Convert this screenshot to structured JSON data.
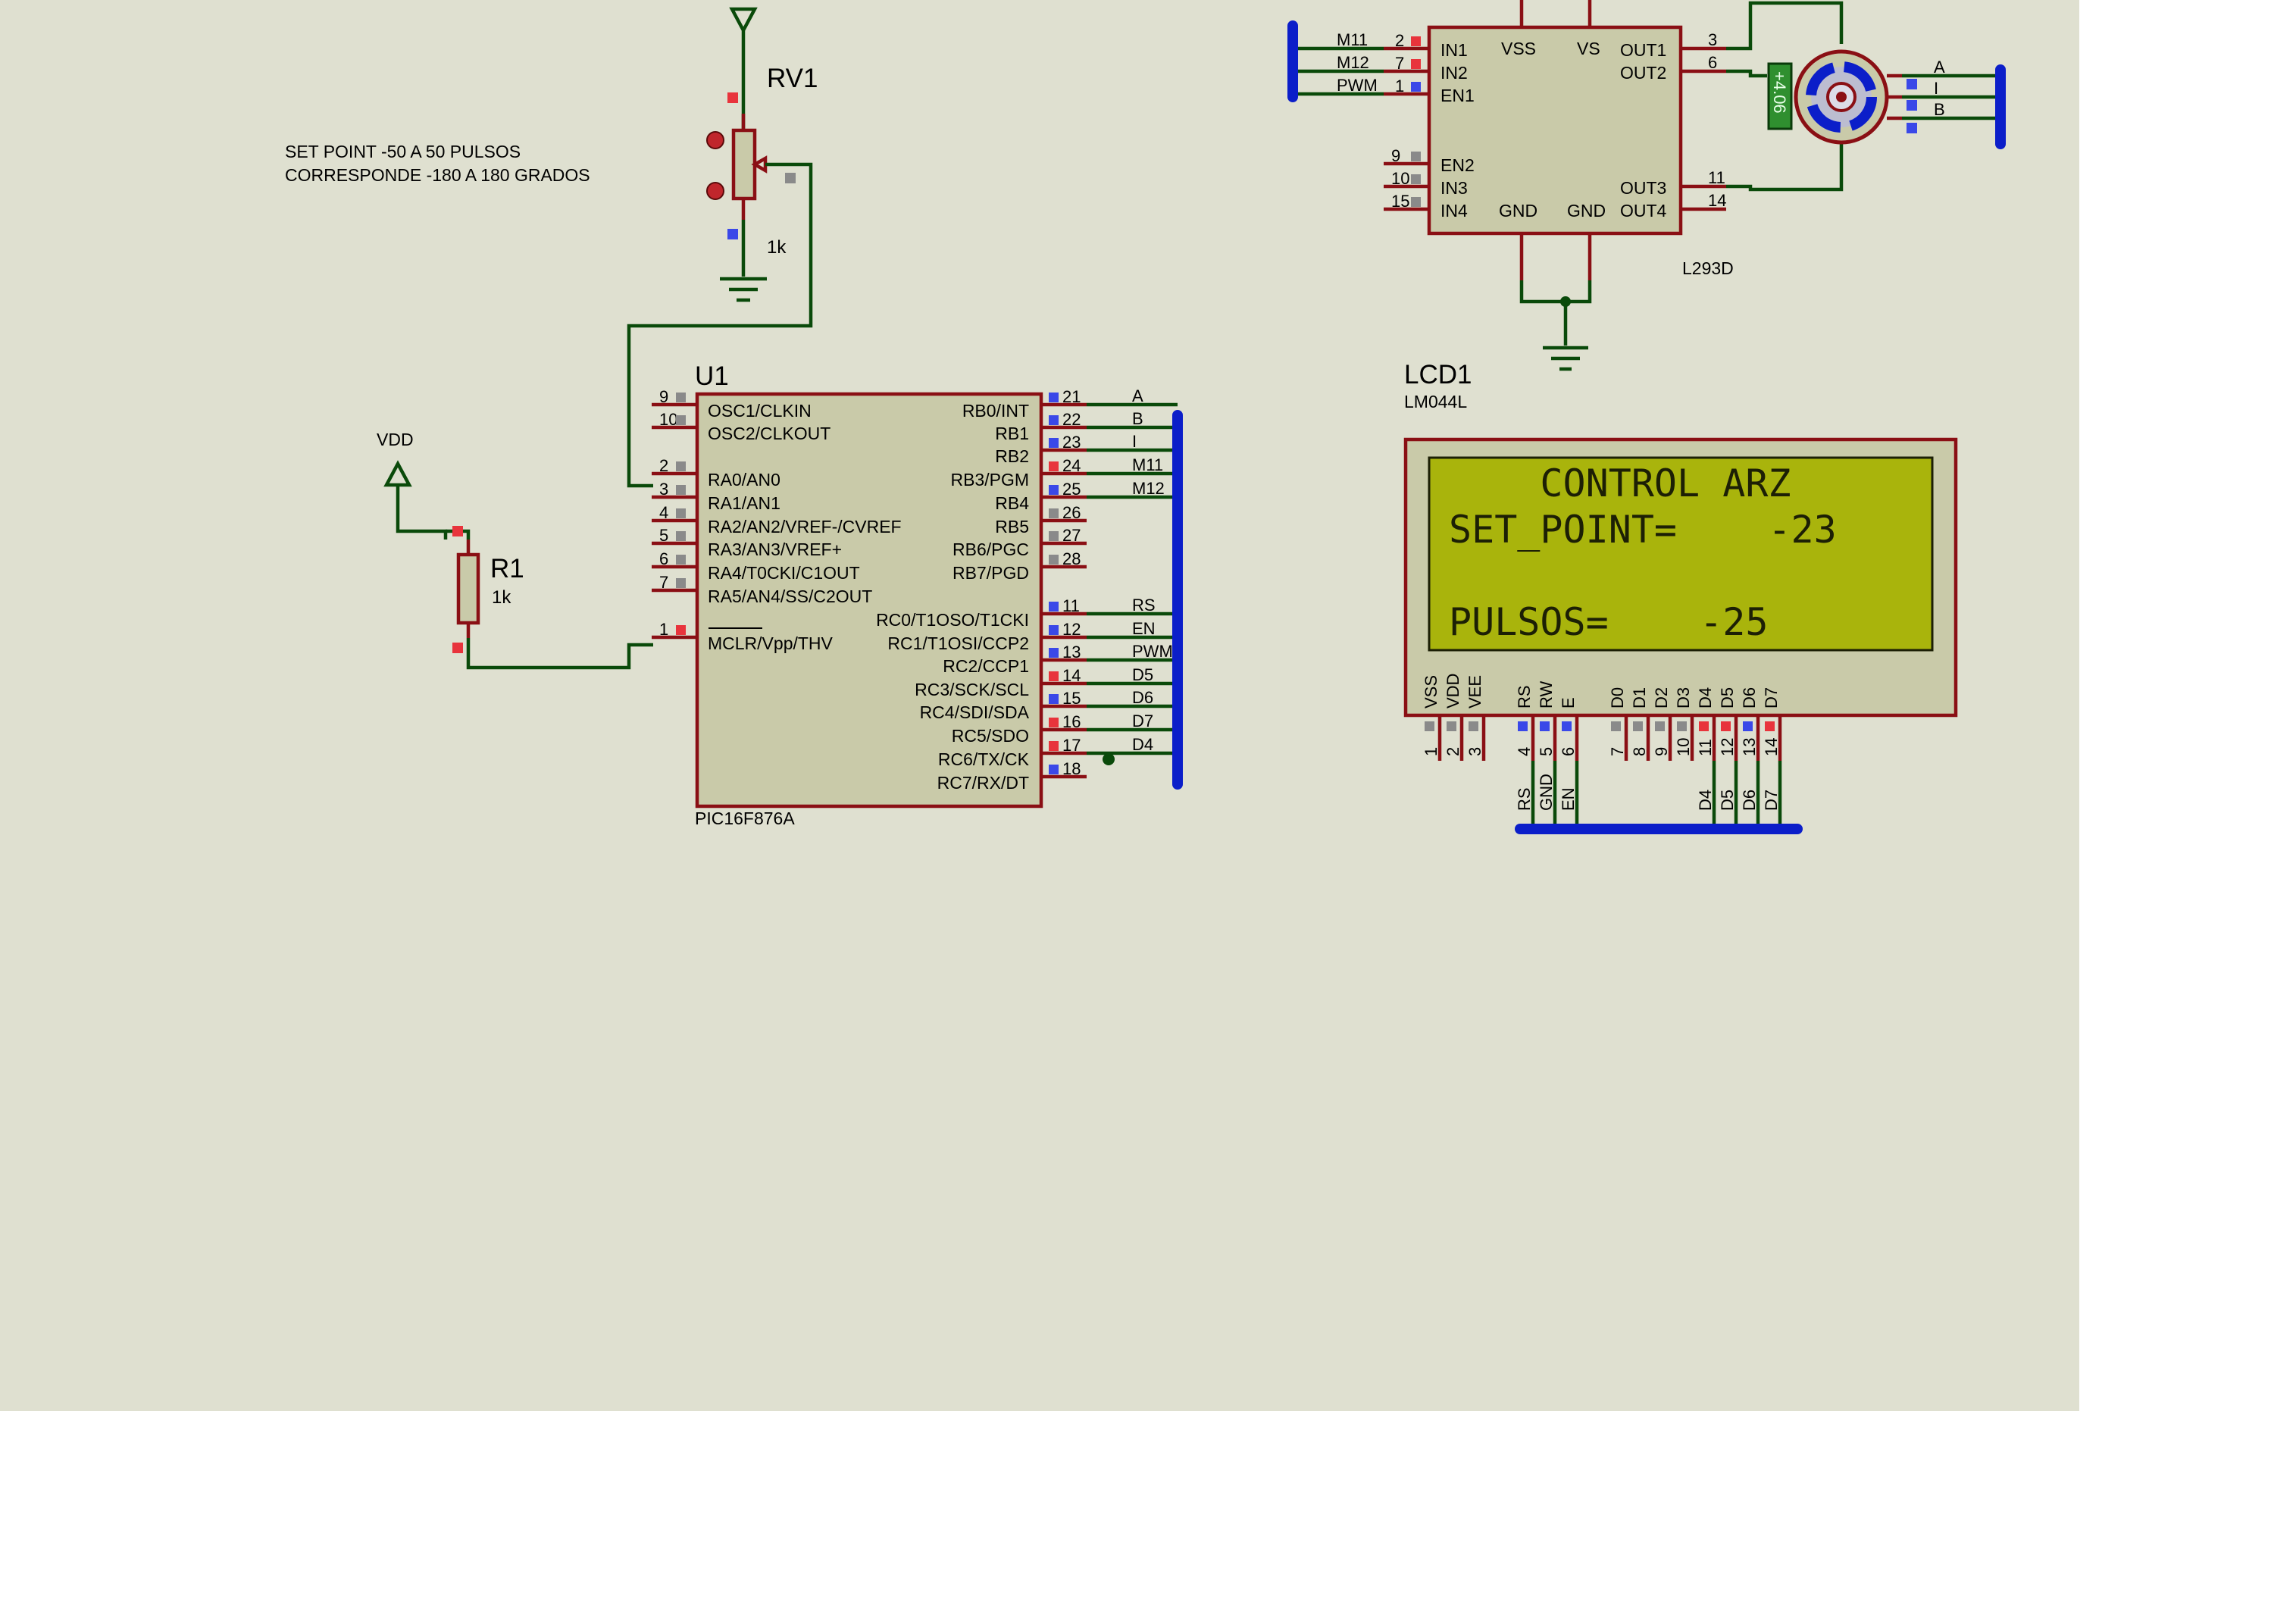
{
  "colors": {
    "sheet": "#dfe0d0",
    "wire": "#0a4a0a",
    "pin": "#8a0f14",
    "bus": "#0b1ec9",
    "chip_fill": "#c9caa9",
    "lcd_screen": "#a9b40c",
    "pin_high": "#e8343c",
    "pin_low": "#3a48e8",
    "pin_float": "#8a8a8a"
  },
  "note": {
    "line1": "SET POINT -50 A 50  PULSOS",
    "line2": "CORRESPONDE -180 A 180 GRADOS"
  },
  "rv1": {
    "ref": "RV1",
    "value": "1k"
  },
  "r1": {
    "ref": "R1",
    "value": "1k"
  },
  "vdd": {
    "label": "VDD"
  },
  "u1": {
    "ref": "U1",
    "part": "PIC16F876A",
    "left_pins": [
      {
        "num": "9",
        "name": "OSC1/CLKIN"
      },
      {
        "num": "10",
        "name": "OSC2/CLKOUT"
      },
      {
        "num": "2",
        "name": "RA0/AN0"
      },
      {
        "num": "3",
        "name": "RA1/AN1"
      },
      {
        "num": "4",
        "name": "RA2/AN2/VREF-/CVREF"
      },
      {
        "num": "5",
        "name": "RA3/AN3/VREF+"
      },
      {
        "num": "6",
        "name": "RA4/T0CKI/C1OUT"
      },
      {
        "num": "7",
        "name": "RA5/AN4/SS/C2OUT"
      },
      {
        "num": "1",
        "name": "MCLR/Vpp/THV"
      }
    ],
    "right_pins": [
      {
        "num": "21",
        "name": "RB0/INT",
        "net": "A"
      },
      {
        "num": "22",
        "name": "RB1",
        "net": "B"
      },
      {
        "num": "23",
        "name": "RB2",
        "net": "I"
      },
      {
        "num": "24",
        "name": "RB3/PGM",
        "net": "M11"
      },
      {
        "num": "25",
        "name": "RB4",
        "net": "M12"
      },
      {
        "num": "26",
        "name": "RB5",
        "net": ""
      },
      {
        "num": "27",
        "name": "RB6/PGC",
        "net": ""
      },
      {
        "num": "28",
        "name": "RB7/PGD",
        "net": ""
      },
      {
        "num": "11",
        "name": "RC0/T1OSO/T1CKI",
        "net": "RS"
      },
      {
        "num": "12",
        "name": "RC1/T1OSI/CCP2",
        "net": "EN"
      },
      {
        "num": "13",
        "name": "RC2/CCP1",
        "net": "PWM"
      },
      {
        "num": "14",
        "name": "RC3/SCK/SCL",
        "net": "D5"
      },
      {
        "num": "15",
        "name": "RC4/SDI/SDA",
        "net": "D6"
      },
      {
        "num": "16",
        "name": "RC5/SDO",
        "net": "D7"
      },
      {
        "num": "17",
        "name": "RC6/TX/CK",
        "net": "D4"
      },
      {
        "num": "18",
        "name": "RC7/RX/DT",
        "net": ""
      }
    ]
  },
  "l293": {
    "part": "L293D",
    "inner": {
      "in1": "IN1",
      "in2": "IN2",
      "en1": "EN1",
      "en2": "EN2",
      "in3": "IN3",
      "in4": "IN4",
      "vss": "VSS",
      "vs": "VS",
      "gnd": "GND",
      "out1": "OUT1",
      "out2": "OUT2",
      "out3": "OUT3",
      "out4": "OUT4"
    },
    "left_nets": [
      {
        "net": "M11",
        "num": "2"
      },
      {
        "net": "M12",
        "num": "7"
      },
      {
        "net": "PWM",
        "num": "1"
      }
    ],
    "left_nums_lower": [
      "9",
      "10",
      "15"
    ],
    "right_nums": [
      "3",
      "6",
      "11",
      "14"
    ]
  },
  "motor": {
    "counter": "+4.06",
    "nets": [
      "A",
      "I",
      "B"
    ]
  },
  "lcd": {
    "ref": "LCD1",
    "part": "LM044L",
    "lines": [
      "    CONTROL ARZ",
      "SET_POINT=    -23",
      "",
      "PULSOS=    -25"
    ],
    "pins": [
      {
        "name": "VSS",
        "num": "1"
      },
      {
        "name": "VDD",
        "num": "2"
      },
      {
        "name": "VEE",
        "num": "3"
      },
      {
        "name": "RS",
        "num": "4"
      },
      {
        "name": "RW",
        "num": "5"
      },
      {
        "name": "E",
        "num": "6"
      },
      {
        "name": "D0",
        "num": "7"
      },
      {
        "name": "D1",
        "num": "8"
      },
      {
        "name": "D2",
        "num": "9"
      },
      {
        "name": "D3",
        "num": "10"
      },
      {
        "name": "D4",
        "num": "11"
      },
      {
        "name": "D5",
        "num": "12"
      },
      {
        "name": "D6",
        "num": "13"
      },
      {
        "name": "D7",
        "num": "14"
      }
    ],
    "bus_nets": [
      "RS",
      "GND",
      "EN",
      "D4",
      "D5",
      "D6",
      "D7"
    ]
  }
}
